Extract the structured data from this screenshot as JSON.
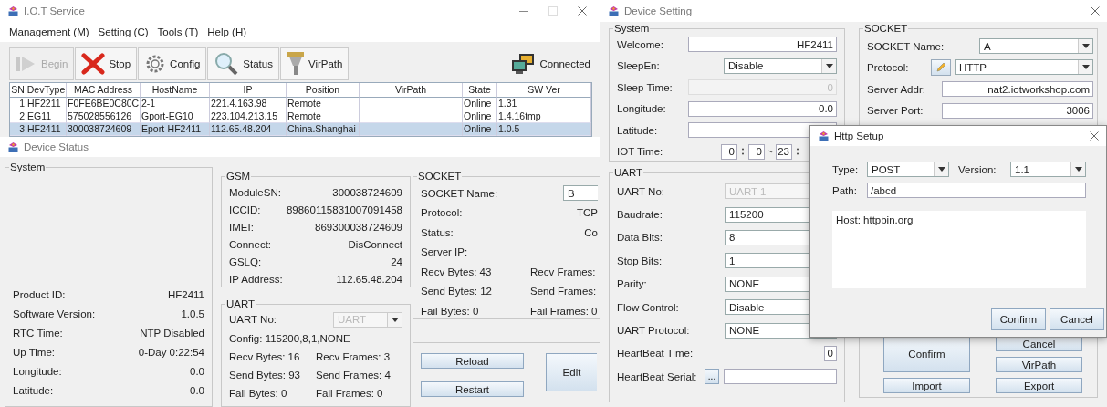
{
  "main_window": {
    "title": "I.O.T Service",
    "menu": [
      "Management (M)",
      "Setting (C)",
      "Tools (T)",
      "Help (H)"
    ],
    "toolbar": [
      {
        "label": "Begin",
        "disabled": true
      },
      {
        "label": "Stop",
        "disabled": false
      },
      {
        "label": "Config",
        "disabled": false
      },
      {
        "label": "Status",
        "disabled": false
      },
      {
        "label": "VirPath",
        "disabled": false
      }
    ],
    "connection_status": "Connected",
    "table": {
      "columns": [
        "SN",
        "DevType",
        "MAC Address",
        "HostName",
        "IP",
        "Position",
        "VirPath",
        "State",
        "SW Ver"
      ],
      "rows": [
        {
          "selected": false,
          "cells": [
            "1",
            "HF2211",
            "F0FE6BE0C80C",
            "2-1",
            "221.4.163.98",
            "Remote",
            "",
            "Online",
            "1.31"
          ]
        },
        {
          "selected": false,
          "cells": [
            "2",
            "EG11",
            "575028556126",
            "Gport-EG10",
            "223.104.213.15",
            "Remote",
            "",
            "Online",
            "1.4.16tmp"
          ]
        },
        {
          "selected": true,
          "cells": [
            "3",
            "HF2411",
            "300038724609",
            "Eport-HF2411",
            "112.65.48.204",
            "China.Shanghai",
            "",
            "Online",
            "1.0.5"
          ]
        }
      ]
    }
  },
  "device_status": {
    "title": "Device Status",
    "system": {
      "title": "System",
      "fields": [
        {
          "label": "Product ID:",
          "value": "HF2411"
        },
        {
          "label": "Software Version:",
          "value": "1.0.5"
        },
        {
          "label": "RTC Time:",
          "value": "NTP Disabled"
        },
        {
          "label": "Up Time:",
          "value": "0-Day 0:22:54"
        },
        {
          "label": "Longitude:",
          "value": "0.0"
        },
        {
          "label": "Latitude:",
          "value": "0.0"
        }
      ]
    },
    "gsm": {
      "title": "GSM",
      "fields": [
        {
          "label": "ModuleSN:",
          "value": "300038724609"
        },
        {
          "label": "ICCID:",
          "value": "89860115831007091458"
        },
        {
          "label": "IMEI:",
          "value": "869300038724609"
        },
        {
          "label": "Connect:",
          "value": "DisConnect"
        },
        {
          "label": "GSLQ:",
          "value": "24"
        },
        {
          "label": "IP Address:",
          "value": "112.65.48.204"
        }
      ]
    },
    "uart": {
      "title": "UART",
      "uart_no": {
        "label": "UART No:",
        "value": "UART",
        "disabled": true
      },
      "config": "Config: 115200,8,1,NONE",
      "stats": [
        [
          "Recv Bytes: 16",
          "Recv Frames: 3"
        ],
        [
          "Send Bytes: 93",
          "Send Frames: 4"
        ],
        [
          "Fail Bytes: 0",
          "Fail Frames: 0"
        ]
      ]
    },
    "socket": {
      "title": "SOCKET",
      "name": {
        "label": "SOCKET Name:",
        "value": "B"
      },
      "fields": [
        {
          "label": "Protocol:",
          "value": "TCP"
        },
        {
          "label": "Status:",
          "value": "Co"
        },
        {
          "label": "Server IP:"
        }
      ],
      "stats": [
        [
          "Recv Bytes: 43",
          "Recv Frames:"
        ],
        [
          "Send Bytes: 12",
          "Send Frames:"
        ],
        [
          "Fail Bytes: 0",
          "Fail Frames: 0"
        ]
      ]
    },
    "buttons": [
      "Reload",
      "Restart",
      "Edit"
    ]
  },
  "device_setting": {
    "title": "Device Setting",
    "system": {
      "title": "System",
      "rows": [
        {
          "kind": "text",
          "label": "Welcome:",
          "value": "HF2411",
          "disabled": false
        },
        {
          "kind": "combo",
          "label": "SleepEn:",
          "value": "Disable",
          "disabled": false
        },
        {
          "kind": "text",
          "label": "Sleep Time:",
          "value": "0",
          "disabled": true
        },
        {
          "kind": "text",
          "label": "Longitude:",
          "value": "0.0",
          "disabled": false
        },
        {
          "kind": "text",
          "label": "Latitude:",
          "disabled": false
        },
        {
          "kind": "time",
          "label": "IOT Time:",
          "values": [
            "0",
            "0",
            "23"
          ],
          "disabled": false
        }
      ]
    },
    "uart": {
      "title": "UART",
      "rows": [
        {
          "kind": "combo",
          "label": "UART No:",
          "value": "UART 1",
          "disabled": true
        },
        {
          "kind": "combo",
          "label": "Baudrate:",
          "value": "115200",
          "disabled": false
        },
        {
          "kind": "combo",
          "label": "Data Bits:",
          "value": "8",
          "disabled": false
        },
        {
          "kind": "combo",
          "label": "Stop Bits:",
          "value": "1",
          "disabled": false
        },
        {
          "kind": "combo",
          "label": "Parity:",
          "value": "NONE",
          "disabled": false
        },
        {
          "kind": "combo",
          "label": "Flow Control:",
          "value": "Disable",
          "disabled": false
        },
        {
          "kind": "combo",
          "label": "UART Protocol:",
          "value": "NONE",
          "disabled": false
        },
        {
          "kind": "text",
          "label": "HeartBeat Time:",
          "value": "0",
          "disabled": false
        },
        {
          "kind": "serial",
          "label": "HeartBeat Serial:",
          "button": "...",
          "disabled": false
        }
      ]
    },
    "socket": {
      "title": "SOCKET",
      "rows": [
        {
          "kind": "combo",
          "label": "SOCKET Name:",
          "value": "A",
          "disabled": false
        },
        {
          "kind": "edit_combo",
          "label": "Protocol:",
          "value": "HTTP",
          "disabled": false
        },
        {
          "kind": "text",
          "label": "Server Addr:",
          "value": "nat2.iotworkshop.com",
          "disabled": false
        },
        {
          "kind": "text",
          "label": "Server Port:",
          "value": "3006",
          "disabled": false
        }
      ]
    },
    "buttons": [
      "Confirm",
      "Import",
      "Cancel",
      "VirPath",
      "Export"
    ]
  },
  "http_setup": {
    "title": "Http Setup",
    "type": {
      "label": "Type:",
      "value": "POST"
    },
    "version": {
      "label": "Version:",
      "value": "1.1"
    },
    "path": {
      "label": "Path:",
      "value": "/abcd"
    },
    "body": "Host: httpbin.org",
    "buttons": [
      "Confirm",
      "Cancel"
    ]
  }
}
